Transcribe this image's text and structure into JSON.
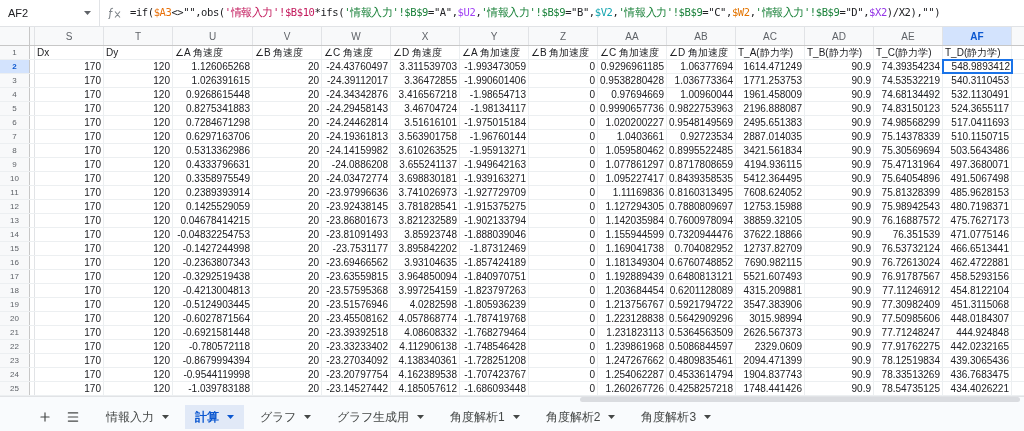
{
  "name_box": {
    "value": "AF2"
  },
  "formula": [
    {
      "text": "=if("
    },
    {
      "text": "$A3",
      "color": "#e8710a"
    },
    {
      "text": "<>\"\",obs("
    },
    {
      "text": "'情報入力'!$B$10",
      "color": "#c2185b"
    },
    {
      "text": "*ifs("
    },
    {
      "text": "'情報入力'!$B$9",
      "color": "#188038"
    },
    {
      "text": "=\"A\","
    },
    {
      "text": "$U2",
      "color": "#a142f4"
    },
    {
      "text": ","
    },
    {
      "text": "'情報入力'!$B$9",
      "color": "#188038"
    },
    {
      "text": "=\"B\","
    },
    {
      "text": "$V2",
      "color": "#12a4af"
    },
    {
      "text": ","
    },
    {
      "text": "'情報入力'!$B$9",
      "color": "#188038"
    },
    {
      "text": "=\"C\","
    },
    {
      "text": "$W2",
      "color": "#e37400"
    },
    {
      "text": ","
    },
    {
      "text": "'情報入力'!$B$9",
      "color": "#188038"
    },
    {
      "text": "=\"D\","
    },
    {
      "text": "$X2",
      "color": "#9334e6"
    },
    {
      "text": ")/X2),\"\")"
    }
  ],
  "columns": [
    {
      "letter": "S",
      "selected": false
    },
    {
      "letter": "T",
      "selected": false
    },
    {
      "letter": "U",
      "selected": false
    },
    {
      "letter": "V",
      "selected": false
    },
    {
      "letter": "W",
      "selected": false
    },
    {
      "letter": "X",
      "selected": false
    },
    {
      "letter": "Y",
      "selected": false
    },
    {
      "letter": "Z",
      "selected": false
    },
    {
      "letter": "AA",
      "selected": false
    },
    {
      "letter": "AB",
      "selected": false
    },
    {
      "letter": "AC",
      "selected": false
    },
    {
      "letter": "AD",
      "selected": false
    },
    {
      "letter": "AE",
      "selected": false
    },
    {
      "letter": "AF",
      "selected": true
    }
  ],
  "rows": [
    {
      "number": "1",
      "kind": "header",
      "selected": false,
      "cells": [
        "Dx",
        "Dy",
        "∠A 角速度",
        "∠B 角速度",
        "∠C 角速度",
        "∠D 角速度",
        "∠A 角加速度",
        "∠B 角加速度",
        "∠C 角加速度",
        "∠D 角加速度",
        "T_A(静力学)",
        "T_B(静力学)",
        "T_C(静力学)",
        "T_D(静力学)"
      ]
    },
    {
      "number": "2",
      "kind": "data",
      "selected": true,
      "cells": [
        "170",
        "120",
        "1.126065268",
        "20",
        "-24.43760497",
        "3.311539703",
        "-1.993473059",
        "0",
        "0.9296961185",
        "1.06377694",
        "1614.471249",
        "90.9",
        "74.39354234",
        "548.9893412"
      ]
    },
    {
      "number": "3",
      "kind": "data",
      "selected": false,
      "cells": [
        "170",
        "120",
        "1.026391615",
        "20",
        "-24.39112017",
        "3.36472855",
        "-1.990601406",
        "0",
        "0.9538280428",
        "1.036773364",
        "1771.253753",
        "90.9",
        "74.53532219",
        "540.3110453"
      ]
    },
    {
      "number": "4",
      "kind": "data",
      "selected": false,
      "cells": [
        "170",
        "120",
        "0.9268615448",
        "20",
        "-24.34342876",
        "3.416567218",
        "-1.98654713",
        "0",
        "0.97694669",
        "1.00960044",
        "1961.458009",
        "90.9",
        "74.68134492",
        "532.1130491"
      ]
    },
    {
      "number": "5",
      "kind": "data",
      "selected": false,
      "cells": [
        "170",
        "120",
        "0.8275341883",
        "20",
        "-24.29458143",
        "3.46704724",
        "-1.98134117",
        "0",
        "0.9990657736",
        "0.9822753963",
        "2196.888087",
        "90.9",
        "74.83150123",
        "524.3655117"
      ]
    },
    {
      "number": "6",
      "kind": "data",
      "selected": false,
      "cells": [
        "170",
        "120",
        "0.7284671298",
        "20",
        "-24.24462814",
        "3.51616101",
        "-1.975015184",
        "0",
        "1.020200227",
        "0.9548149569",
        "2495.651383",
        "90.9",
        "74.98568299",
        "517.0411693"
      ]
    },
    {
      "number": "7",
      "kind": "data",
      "selected": false,
      "cells": [
        "170",
        "120",
        "0.6297163706",
        "20",
        "-24.19361813",
        "3.563901758",
        "-1.96760144",
        "0",
        "1.0403661",
        "0.92723534",
        "2887.014035",
        "90.9",
        "75.14378339",
        "510.1150715"
      ]
    },
    {
      "number": "8",
      "kind": "data",
      "selected": false,
      "cells": [
        "170",
        "120",
        "0.5313362986",
        "20",
        "-24.14159982",
        "3.610263525",
        "-1.95913271",
        "0",
        "1.059580462",
        "0.8995522485",
        "3421.561834",
        "90.9",
        "75.30569694",
        "503.5643486"
      ]
    },
    {
      "number": "9",
      "kind": "data",
      "selected": false,
      "cells": [
        "170",
        "120",
        "0.4333796631",
        "20",
        "-24.0886208",
        "3.655241137",
        "-1.949642163",
        "0",
        "1.077861297",
        "0.8717808659",
        "4194.936115",
        "90.9",
        "75.47131964",
        "497.3680071"
      ]
    },
    {
      "number": "10",
      "kind": "data",
      "selected": false,
      "cells": [
        "170",
        "120",
        "0.3358975549",
        "20",
        "-24.03472774",
        "3.698830181",
        "-1.939163271",
        "0",
        "1.095227417",
        "0.8439358535",
        "5412.364495",
        "90.9",
        "75.64054896",
        "491.5067498"
      ]
    },
    {
      "number": "11",
      "kind": "data",
      "selected": false,
      "cells": [
        "170",
        "120",
        "0.2389393914",
        "20",
        "-23.97996636",
        "3.741026973",
        "-1.927729709",
        "0",
        "1.11169836",
        "0.8160313495",
        "7608.624052",
        "90.9",
        "75.81328399",
        "485.9628153"
      ]
    },
    {
      "number": "12",
      "kind": "data",
      "selected": false,
      "cells": [
        "170",
        "120",
        "0.1425529059",
        "20",
        "-23.92438145",
        "3.781828541",
        "-1.915375275",
        "0",
        "1.127294305",
        "0.7880809697",
        "12753.15988",
        "90.9",
        "75.98942543",
        "480.7198371"
      ]
    },
    {
      "number": "13",
      "kind": "data",
      "selected": false,
      "cells": [
        "170",
        "120",
        "0.04678414215",
        "20",
        "-23.86801673",
        "3.821232589",
        "-1.902133794",
        "0",
        "1.142035984",
        "0.7600978094",
        "38859.32105",
        "90.9",
        "76.16887572",
        "475.7627173"
      ]
    },
    {
      "number": "14",
      "kind": "data",
      "selected": false,
      "cells": [
        "170",
        "120",
        "-0.04832254753",
        "20",
        "-23.81091493",
        "3.85923748",
        "-1.888039046",
        "0",
        "1.155944599",
        "0.7320944476",
        "37622.18866",
        "90.9",
        "76.351539",
        "471.0775146"
      ]
    },
    {
      "number": "15",
      "kind": "data",
      "selected": false,
      "cells": [
        "170",
        "120",
        "-0.1427244998",
        "20",
        "-23.7531177",
        "3.895842202",
        "-1.87312469",
        "0",
        "1.169041738",
        "0.704082952",
        "12737.82709",
        "90.9",
        "76.53732124",
        "466.6513441"
      ]
    },
    {
      "number": "16",
      "kind": "data",
      "selected": false,
      "cells": [
        "170",
        "120",
        "-0.2363807343",
        "20",
        "-23.69466562",
        "3.93104635",
        "-1.857424189",
        "0",
        "1.181349304",
        "0.6760748852",
        "7690.982115",
        "90.9",
        "76.72613024",
        "462.4722881"
      ]
    },
    {
      "number": "17",
      "kind": "data",
      "selected": false,
      "cells": [
        "170",
        "120",
        "-0.3292519438",
        "20",
        "-23.63559815",
        "3.964850094",
        "-1.840970751",
        "0",
        "1.192889439",
        "0.6480813121",
        "5521.607493",
        "90.9",
        "76.91787567",
        "458.5293156"
      ]
    },
    {
      "number": "18",
      "kind": "data",
      "selected": false,
      "cells": [
        "170",
        "120",
        "-0.4213004813",
        "20",
        "-23.57595368",
        "3.997254159",
        "-1.823797263",
        "0",
        "1.203684454",
        "0.6201128089",
        "4315.209881",
        "90.9",
        "77.11246912",
        "454.8122104"
      ]
    },
    {
      "number": "19",
      "kind": "data",
      "selected": false,
      "cells": [
        "170",
        "120",
        "-0.5124903445",
        "20",
        "-23.51576946",
        "4.0282598",
        "-1.805936239",
        "0",
        "1.213756767",
        "0.5921794722",
        "3547.383906",
        "90.9",
        "77.30982409",
        "451.3115068"
      ]
    },
    {
      "number": "20",
      "kind": "data",
      "selected": false,
      "cells": [
        "170",
        "120",
        "-0.6027871564",
        "20",
        "-23.45508162",
        "4.057868774",
        "-1.787419768",
        "0",
        "1.223128838",
        "0.5642909296",
        "3015.98994",
        "90.9",
        "77.50985606",
        "448.0184307"
      ]
    },
    {
      "number": "21",
      "kind": "data",
      "selected": false,
      "cells": [
        "170",
        "120",
        "-0.6921581448",
        "20",
        "-23.39392518",
        "4.08608332",
        "-1.768279464",
        "0",
        "1.231823113",
        "0.5364563509",
        "2626.567373",
        "90.9",
        "77.71248247",
        "444.924848"
      ]
    },
    {
      "number": "22",
      "kind": "data",
      "selected": false,
      "cells": [
        "170",
        "120",
        "-0.780572118",
        "20",
        "-23.33233402",
        "4.112906138",
        "-1.748546428",
        "0",
        "1.239861968",
        "0.5086844597",
        "2329.0609",
        "90.9",
        "77.91762275",
        "442.0232165"
      ]
    },
    {
      "number": "23",
      "kind": "data",
      "selected": false,
      "cells": [
        "170",
        "120",
        "-0.8679994394",
        "20",
        "-23.27034092",
        "4.138340361",
        "-1.728251208",
        "0",
        "1.247267662",
        "0.4809835461",
        "2094.471399",
        "90.9",
        "78.12519834",
        "439.3065436"
      ]
    },
    {
      "number": "24",
      "kind": "data",
      "selected": false,
      "cells": [
        "170",
        "120",
        "-0.9544119998",
        "20",
        "-23.20797754",
        "4.162389538",
        "-1.707423767",
        "0",
        "1.254062287",
        "0.4533614794",
        "1904.837743",
        "90.9",
        "78.33513269",
        "436.7683475"
      ]
    },
    {
      "number": "25",
      "kind": "data",
      "selected": false,
      "cells": [
        "170",
        "120",
        "-1.039783188",
        "20",
        "-23.14527442",
        "4.185057612",
        "-1.686093448",
        "0",
        "1.260267726",
        "0.4258257218",
        "1748.441426",
        "90.9",
        "78.54735125",
        "434.4026221"
      ]
    }
  ],
  "sheet_tabs": [
    {
      "label": "情報入力",
      "selected": false
    },
    {
      "label": "計算",
      "selected": true
    },
    {
      "label": "グラフ",
      "selected": false
    },
    {
      "label": "グラフ生成用",
      "selected": false
    },
    {
      "label": "角度解析1",
      "selected": false
    },
    {
      "label": "角度解析2",
      "selected": false
    },
    {
      "label": "角度解析3",
      "selected": false
    }
  ]
}
